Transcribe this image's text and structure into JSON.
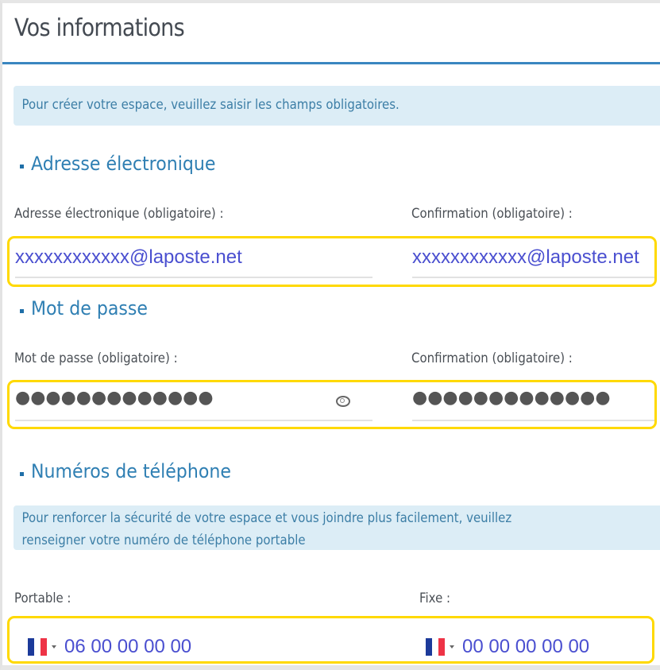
{
  "page": {
    "title": "Vos informations",
    "intro_banner": "Pour créer votre espace, veuillez saisir les champs obligatoires."
  },
  "sections": {
    "email": {
      "heading": "Adresse électronique",
      "email_label": "Adresse électronique (obligatoire) :",
      "email_value": "xxxxxxxxxxxx@laposte.net",
      "confirm_label": "Confirmation (obligatoire) :",
      "confirm_value": "xxxxxxxxxxxx@laposte.net"
    },
    "password": {
      "heading": "Mot de passe",
      "password_label": "Mot de passe (obligatoire) :",
      "password_value": "●●●●●●●●●●●●●",
      "show_password_icon": "eye-icon",
      "confirm_label": "Confirmation (obligatoire) :",
      "confirm_value": "●●●●●●●●●●●●●"
    },
    "phone": {
      "heading": "Numéros de téléphone",
      "banner_line1": "Pour renforcer la sécurité de votre espace et vous joindre plus facilement, veuillez",
      "banner_line2": "renseigner votre numéro de téléphone portable",
      "mobile_label": "Portable :",
      "mobile_country": "FR",
      "mobile_value": "06 00 00 00 00",
      "landline_label": "Fixe :",
      "landline_country": "FR",
      "landline_value": "00 00 00 00 00"
    }
  },
  "colors": {
    "accent": "#3a86c0",
    "section_heading": "#2f7fb3",
    "banner_bg": "#dcedf6",
    "banner_text": "#3c7ea6",
    "input_text": "#4a4fd0",
    "annotation_highlight": "#ffd900"
  }
}
